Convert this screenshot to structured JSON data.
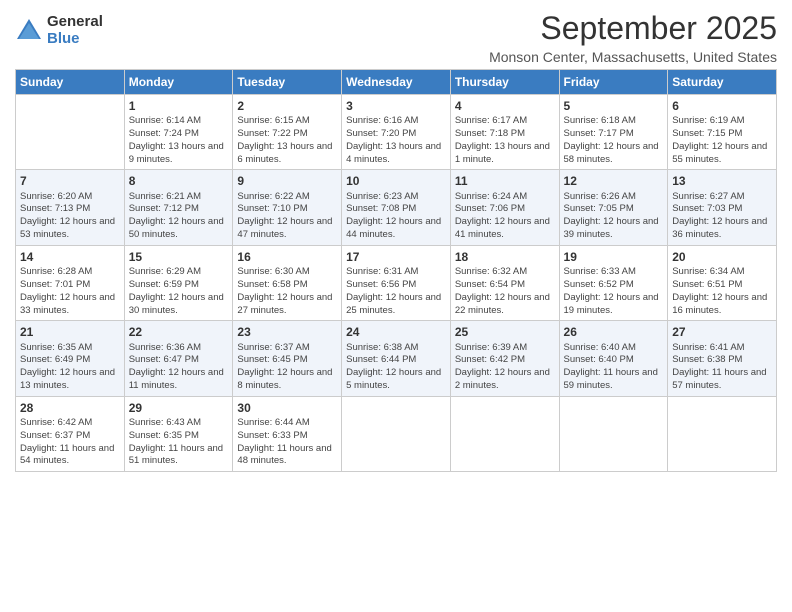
{
  "header": {
    "logo_general": "General",
    "logo_blue": "Blue",
    "month_title": "September 2025",
    "location": "Monson Center, Massachusetts, United States"
  },
  "days_of_week": [
    "Sunday",
    "Monday",
    "Tuesday",
    "Wednesday",
    "Thursday",
    "Friday",
    "Saturday"
  ],
  "weeks": [
    [
      {
        "day": "",
        "sunrise": "",
        "sunset": "",
        "daylight": ""
      },
      {
        "day": "1",
        "sunrise": "6:14 AM",
        "sunset": "7:24 PM",
        "daylight": "13 hours and 9 minutes."
      },
      {
        "day": "2",
        "sunrise": "6:15 AM",
        "sunset": "7:22 PM",
        "daylight": "13 hours and 6 minutes."
      },
      {
        "day": "3",
        "sunrise": "6:16 AM",
        "sunset": "7:20 PM",
        "daylight": "13 hours and 4 minutes."
      },
      {
        "day": "4",
        "sunrise": "6:17 AM",
        "sunset": "7:18 PM",
        "daylight": "13 hours and 1 minute."
      },
      {
        "day": "5",
        "sunrise": "6:18 AM",
        "sunset": "7:17 PM",
        "daylight": "12 hours and 58 minutes."
      },
      {
        "day": "6",
        "sunrise": "6:19 AM",
        "sunset": "7:15 PM",
        "daylight": "12 hours and 55 minutes."
      }
    ],
    [
      {
        "day": "7",
        "sunrise": "6:20 AM",
        "sunset": "7:13 PM",
        "daylight": "12 hours and 53 minutes."
      },
      {
        "day": "8",
        "sunrise": "6:21 AM",
        "sunset": "7:12 PM",
        "daylight": "12 hours and 50 minutes."
      },
      {
        "day": "9",
        "sunrise": "6:22 AM",
        "sunset": "7:10 PM",
        "daylight": "12 hours and 47 minutes."
      },
      {
        "day": "10",
        "sunrise": "6:23 AM",
        "sunset": "7:08 PM",
        "daylight": "12 hours and 44 minutes."
      },
      {
        "day": "11",
        "sunrise": "6:24 AM",
        "sunset": "7:06 PM",
        "daylight": "12 hours and 41 minutes."
      },
      {
        "day": "12",
        "sunrise": "6:26 AM",
        "sunset": "7:05 PM",
        "daylight": "12 hours and 39 minutes."
      },
      {
        "day": "13",
        "sunrise": "6:27 AM",
        "sunset": "7:03 PM",
        "daylight": "12 hours and 36 minutes."
      }
    ],
    [
      {
        "day": "14",
        "sunrise": "6:28 AM",
        "sunset": "7:01 PM",
        "daylight": "12 hours and 33 minutes."
      },
      {
        "day": "15",
        "sunrise": "6:29 AM",
        "sunset": "6:59 PM",
        "daylight": "12 hours and 30 minutes."
      },
      {
        "day": "16",
        "sunrise": "6:30 AM",
        "sunset": "6:58 PM",
        "daylight": "12 hours and 27 minutes."
      },
      {
        "day": "17",
        "sunrise": "6:31 AM",
        "sunset": "6:56 PM",
        "daylight": "12 hours and 25 minutes."
      },
      {
        "day": "18",
        "sunrise": "6:32 AM",
        "sunset": "6:54 PM",
        "daylight": "12 hours and 22 minutes."
      },
      {
        "day": "19",
        "sunrise": "6:33 AM",
        "sunset": "6:52 PM",
        "daylight": "12 hours and 19 minutes."
      },
      {
        "day": "20",
        "sunrise": "6:34 AM",
        "sunset": "6:51 PM",
        "daylight": "12 hours and 16 minutes."
      }
    ],
    [
      {
        "day": "21",
        "sunrise": "6:35 AM",
        "sunset": "6:49 PM",
        "daylight": "12 hours and 13 minutes."
      },
      {
        "day": "22",
        "sunrise": "6:36 AM",
        "sunset": "6:47 PM",
        "daylight": "12 hours and 11 minutes."
      },
      {
        "day": "23",
        "sunrise": "6:37 AM",
        "sunset": "6:45 PM",
        "daylight": "12 hours and 8 minutes."
      },
      {
        "day": "24",
        "sunrise": "6:38 AM",
        "sunset": "6:44 PM",
        "daylight": "12 hours and 5 minutes."
      },
      {
        "day": "25",
        "sunrise": "6:39 AM",
        "sunset": "6:42 PM",
        "daylight": "12 hours and 2 minutes."
      },
      {
        "day": "26",
        "sunrise": "6:40 AM",
        "sunset": "6:40 PM",
        "daylight": "11 hours and 59 minutes."
      },
      {
        "day": "27",
        "sunrise": "6:41 AM",
        "sunset": "6:38 PM",
        "daylight": "11 hours and 57 minutes."
      }
    ],
    [
      {
        "day": "28",
        "sunrise": "6:42 AM",
        "sunset": "6:37 PM",
        "daylight": "11 hours and 54 minutes."
      },
      {
        "day": "29",
        "sunrise": "6:43 AM",
        "sunset": "6:35 PM",
        "daylight": "11 hours and 51 minutes."
      },
      {
        "day": "30",
        "sunrise": "6:44 AM",
        "sunset": "6:33 PM",
        "daylight": "11 hours and 48 minutes."
      },
      {
        "day": "",
        "sunrise": "",
        "sunset": "",
        "daylight": ""
      },
      {
        "day": "",
        "sunrise": "",
        "sunset": "",
        "daylight": ""
      },
      {
        "day": "",
        "sunrise": "",
        "sunset": "",
        "daylight": ""
      },
      {
        "day": "",
        "sunrise": "",
        "sunset": "",
        "daylight": ""
      }
    ]
  ]
}
